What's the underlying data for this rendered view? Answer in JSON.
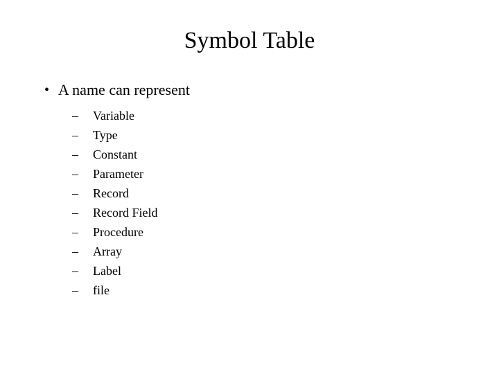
{
  "title": "Symbol Table",
  "bullet": "A name can represent",
  "items": [
    "Variable",
    "Type",
    "Constant",
    "Parameter",
    "Record",
    "Record Field",
    "Procedure",
    "Array",
    "Label",
    "file"
  ]
}
